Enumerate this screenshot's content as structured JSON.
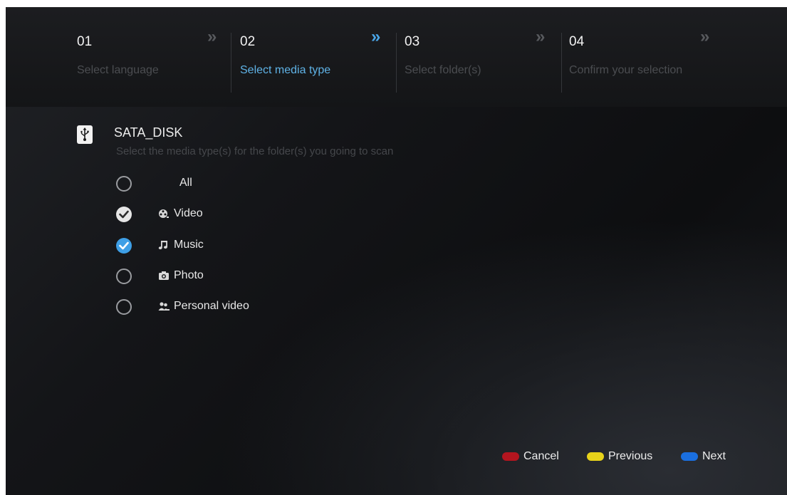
{
  "steps": [
    {
      "num": "01",
      "label": "Select language",
      "active": false
    },
    {
      "num": "02",
      "label": "Select media type",
      "active": true
    },
    {
      "num": "03",
      "label": "Select folder(s)",
      "active": false
    },
    {
      "num": "04",
      "label": "Confirm your selection",
      "active": false
    }
  ],
  "chevron": "»",
  "device": {
    "name": "SATA_DISK",
    "subtitle": "Select the media type(s) for the folder(s) you going to scan",
    "icon": "usb-icon"
  },
  "options": [
    {
      "label": "All",
      "checked": false,
      "icon": ""
    },
    {
      "label": "Video",
      "checked": true,
      "icon": "film-reel-icon"
    },
    {
      "label": "Music",
      "checked": true,
      "icon": "music-note-icon",
      "focused": true
    },
    {
      "label": "Photo",
      "checked": false,
      "icon": "camera-icon"
    },
    {
      "label": "Personal video",
      "checked": false,
      "icon": "people-video-icon"
    }
  ],
  "keys": {
    "cancel": {
      "label": "Cancel",
      "color": "#b3151f"
    },
    "previous": {
      "label": "Previous",
      "color": "#e8d31a"
    },
    "next": {
      "label": "Next",
      "color": "#1a6fe0"
    }
  },
  "colors": {
    "accent": "#4aa6e8",
    "check_blue": "#3e9fe6"
  }
}
